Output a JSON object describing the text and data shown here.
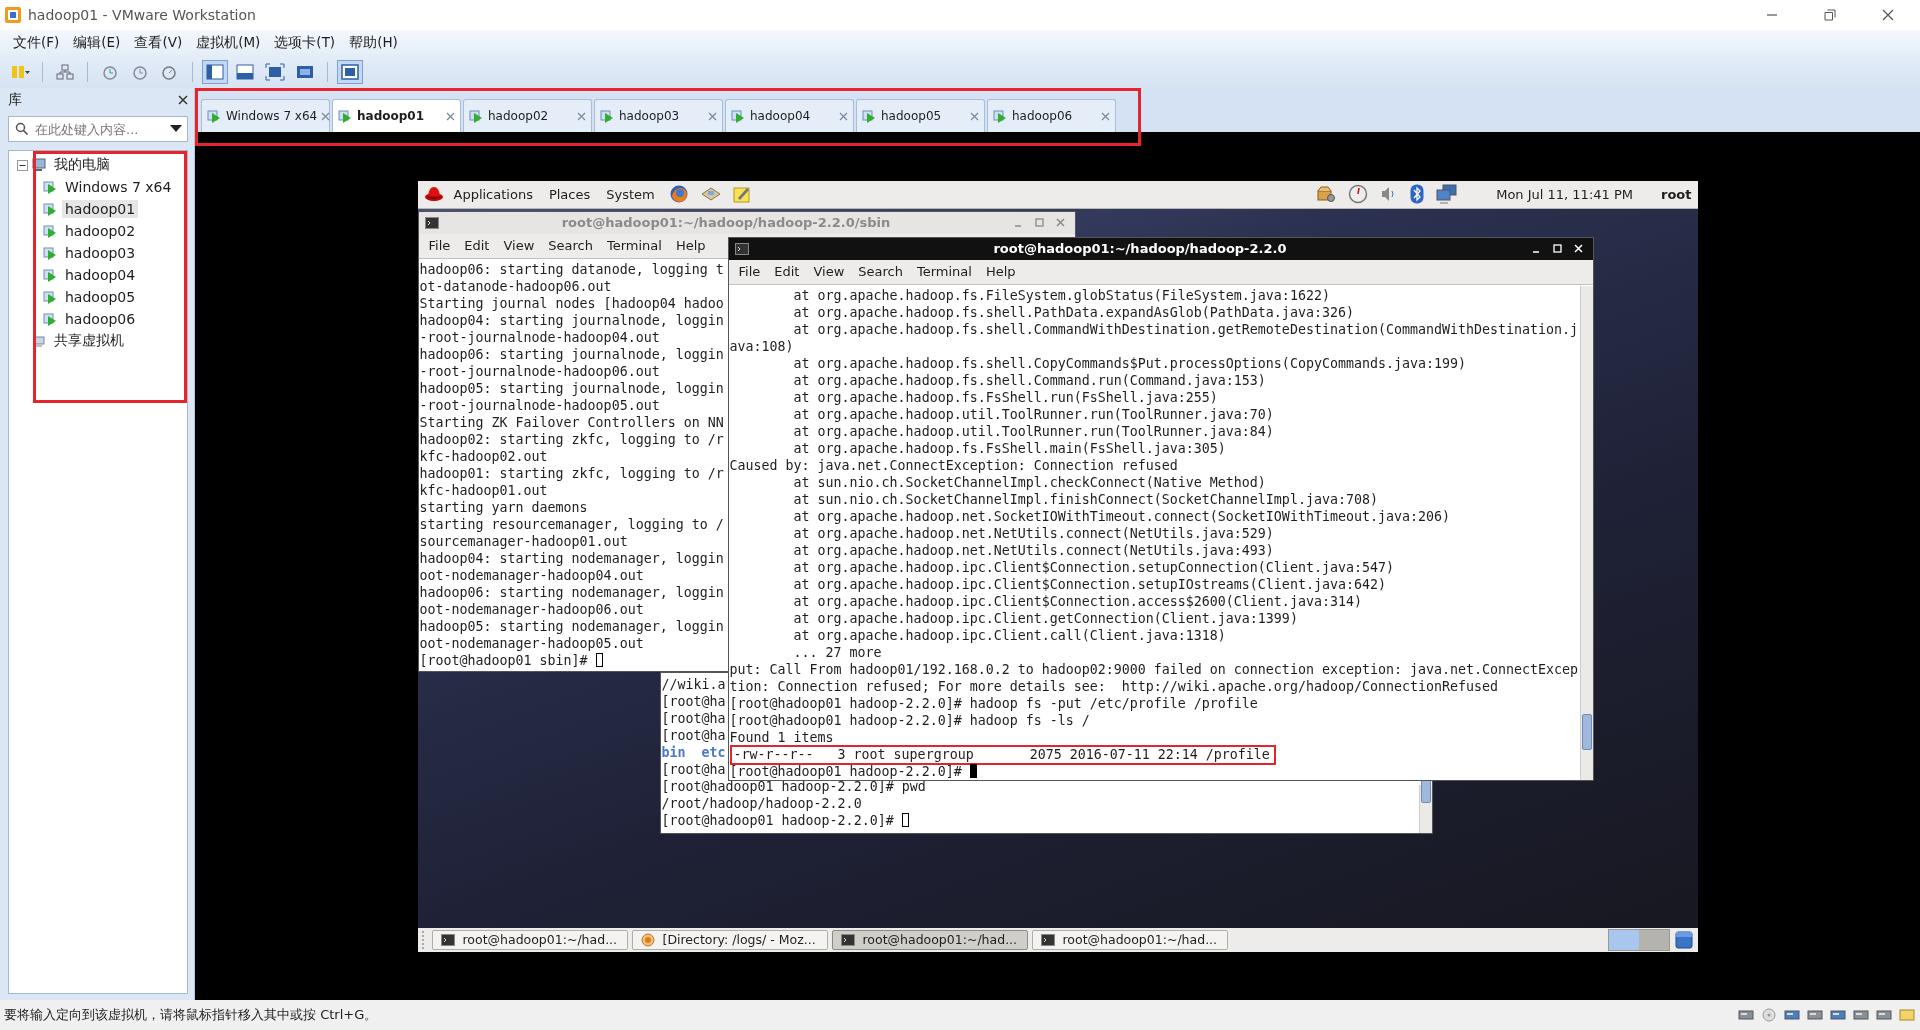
{
  "window": {
    "title": "hadoop01 - VMware Workstation"
  },
  "menu": [
    "文件(F)",
    "编辑(E)",
    "查看(V)",
    "虚拟机(M)",
    "选项卡(T)",
    "帮助(H)"
  ],
  "library": {
    "title": "库",
    "search": {
      "placeholder": "在此处键入内容..."
    },
    "highlighted": true,
    "tree": [
      {
        "label": "我的电脑",
        "expanded": true,
        "selected": false,
        "children": [
          {
            "label": "Windows 7 x64",
            "selected": false
          },
          {
            "label": "hadoop01",
            "selected": true
          },
          {
            "label": "hadoop02",
            "selected": false
          },
          {
            "label": "hadoop03",
            "selected": false
          },
          {
            "label": "hadoop04",
            "selected": false
          },
          {
            "label": "hadoop05",
            "selected": false
          },
          {
            "label": "hadoop06",
            "selected": false
          }
        ]
      },
      {
        "label": "共享虚拟机",
        "selected": false
      }
    ]
  },
  "tabs": {
    "highlighted": true,
    "items": [
      {
        "label": "Windows 7 x64",
        "selected": false
      },
      {
        "label": "hadoop01",
        "selected": true
      },
      {
        "label": "hadoop02",
        "selected": false
      },
      {
        "label": "hadoop03",
        "selected": false
      },
      {
        "label": "hadoop04",
        "selected": false
      },
      {
        "label": "hadoop05",
        "selected": false
      },
      {
        "label": "hadoop06",
        "selected": false
      }
    ]
  },
  "guest": {
    "panel": {
      "menus": [
        "Applications",
        "Places",
        "System"
      ],
      "clock": "Mon Jul 11, 11:41 PM",
      "user": "root"
    },
    "terminals": [
      {
        "title": "root@hadoop01:~/hadoop/hadoop-2.2.0/sbin",
        "active": false,
        "menus": [
          "File",
          "Edit",
          "View",
          "Search",
          "Terminal",
          "Help"
        ],
        "lines": [
          {
            "text": "hadoop06: starting datanode, logging t"
          },
          {
            "text": "ot-datanode-hadoop06.out"
          },
          {
            "text": "Starting journal nodes [hadoop04 hadoo"
          },
          {
            "text": "hadoop04: starting journalnode, loggin"
          },
          {
            "text": "-root-journalnode-hadoop04.out"
          },
          {
            "text": "hadoop06: starting journalnode, loggin"
          },
          {
            "text": "-root-journalnode-hadoop06.out"
          },
          {
            "text": "hadoop05: starting journalnode, loggin"
          },
          {
            "text": "-root-journalnode-hadoop05.out"
          },
          {
            "text": "Starting ZK Failover Controllers on NN"
          },
          {
            "text": "hadoop02: starting zkfc, logging to /r"
          },
          {
            "text": "kfc-hadoop02.out"
          },
          {
            "text": "hadoop01: starting zkfc, logging to /r"
          },
          {
            "text": "kfc-hadoop01.out"
          },
          {
            "text": "starting yarn daemons"
          },
          {
            "text": "starting resourcemanager, logging to /"
          },
          {
            "text": "sourcemanager-hadoop01.out"
          },
          {
            "text": "hadoop04: starting nodemanager, loggin"
          },
          {
            "text": "oot-nodemanager-hadoop04.out"
          },
          {
            "text": "hadoop06: starting nodemanager, loggin"
          },
          {
            "text": "oot-nodemanager-hadoop06.out"
          },
          {
            "text": "hadoop05: starting nodemanager, loggin"
          },
          {
            "text": "oot-nodemanager-hadoop05.out"
          },
          {
            "text": "[root@hadoop01 sbin]# ",
            "cursor": true
          }
        ]
      },
      {
        "title": "root@hadoop01:~/hadoop/hadoop-2.2.0",
        "active": true,
        "menus": [
          "File",
          "Edit",
          "View",
          "Search",
          "Terminal",
          "Help"
        ],
        "lines": [
          {
            "text": "        at org.apache.hadoop.fs.FileSystem.globStatus(FileSystem.java:1622)"
          },
          {
            "text": "        at org.apache.hadoop.fs.shell.PathData.expandAsGlob(PathData.java:326)"
          },
          {
            "text": "        at org.apache.hadoop.fs.shell.CommandWithDestination.getRemoteDestination(CommandWithDestination.j"
          },
          {
            "text": "ava:108)"
          },
          {
            "text": "        at org.apache.hadoop.fs.shell.CopyCommands$Put.processOptions(CopyCommands.java:199)"
          },
          {
            "text": "        at org.apache.hadoop.fs.shell.Command.run(Command.java:153)"
          },
          {
            "text": "        at org.apache.hadoop.fs.FsShell.run(FsShell.java:255)"
          },
          {
            "text": "        at org.apache.hadoop.util.ToolRunner.run(ToolRunner.java:70)"
          },
          {
            "text": "        at org.apache.hadoop.util.ToolRunner.run(ToolRunner.java:84)"
          },
          {
            "text": "        at org.apache.hadoop.fs.FsShell.main(FsShell.java:305)"
          },
          {
            "text": "Caused by: java.net.ConnectException: Connection refused"
          },
          {
            "text": "        at sun.nio.ch.SocketChannelImpl.checkConnect(Native Method)"
          },
          {
            "text": "        at sun.nio.ch.SocketChannelImpl.finishConnect(SocketChannelImpl.java:708)"
          },
          {
            "text": "        at org.apache.hadoop.net.SocketIOWithTimeout.connect(SocketIOWithTimeout.java:206)"
          },
          {
            "text": "        at org.apache.hadoop.net.NetUtils.connect(NetUtils.java:529)"
          },
          {
            "text": "        at org.apache.hadoop.net.NetUtils.connect(NetUtils.java:493)"
          },
          {
            "text": "        at org.apache.hadoop.ipc.Client$Connection.setupConnection(Client.java:547)"
          },
          {
            "text": "        at org.apache.hadoop.ipc.Client$Connection.setupIOstreams(Client.java:642)"
          },
          {
            "text": "        at org.apache.hadoop.ipc.Client$Connection.access$2600(Client.java:314)"
          },
          {
            "text": "        at org.apache.hadoop.ipc.Client.getConnection(Client.java:1399)"
          },
          {
            "text": "        at org.apache.hadoop.ipc.Client.call(Client.java:1318)"
          },
          {
            "text": "        ... 27 more"
          },
          {
            "text": "put: Call From hadoop01/192.168.0.2 to hadoop02:9000 failed on connection exception: java.net.ConnectExcep"
          },
          {
            "text": "tion: Connection refused; For more details see:  http://wiki.apache.org/hadoop/ConnectionRefused"
          },
          {
            "text": "[root@hadoop01 hadoop-2.2.0]# hadoop fs -put /etc/profile /profile"
          },
          {
            "text": "[root@hadoop01 hadoop-2.2.0]# hadoop fs -ls /"
          },
          {
            "text": "Found 1 items"
          },
          {
            "text": "-rw-r--r--   3 root supergroup       2075 2016-07-11 22:14 /profile",
            "highlighted": true
          },
          {
            "text": "[root@hadoop01 hadoop-2.2.0]# ",
            "cursor": true
          }
        ]
      },
      {
        "lines": [
          {
            "text": "//wiki.a"
          },
          {
            "text": "[root@ha"
          },
          {
            "text": "[root@ha"
          },
          {
            "text": "[root@ha"
          },
          {
            "text": "bin  etc",
            "kind": "listing"
          },
          {
            "text": "[root@ha"
          },
          {
            "text": "[root@hadoop01 hadoop-2.2.0]# pwd"
          },
          {
            "text": "/root/hadoop/hadoop-2.2.0"
          },
          {
            "text": "[root@hadoop01 hadoop-2.2.0]# ",
            "cursor": true
          }
        ]
      }
    ],
    "taskbar": [
      {
        "label": "root@hadoop01:~/had...",
        "kind": "terminal",
        "selected": false
      },
      {
        "label": "[Directory: /logs/ - Moz...",
        "kind": "browser",
        "selected": false
      },
      {
        "label": "root@hadoop01:~/had...",
        "kind": "terminal",
        "selected": true
      },
      {
        "label": "root@hadoop01:~/had...",
        "kind": "terminal",
        "selected": false
      }
    ]
  },
  "status_bar": {
    "text": "要将输入定向到该虚拟机，请将鼠标指针移入其中或按 Ctrl+G。"
  }
}
